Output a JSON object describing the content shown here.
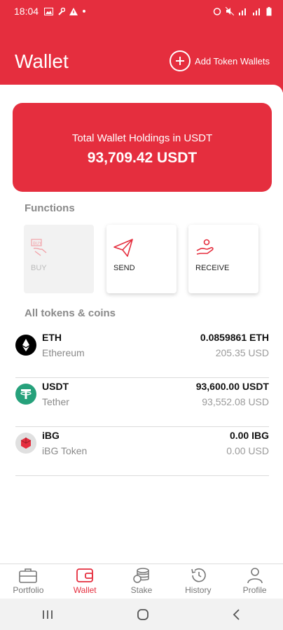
{
  "status_bar": {
    "time": "18:04"
  },
  "header": {
    "title": "Wallet",
    "add_token_label": "Add Token Wallets"
  },
  "holdings": {
    "label": "Total Wallet Holdings in USDT",
    "amount": "93,709.42 USDT"
  },
  "functions": {
    "title": "Functions",
    "items": [
      {
        "label": "BUY",
        "icon": "buy-icon",
        "enabled": false
      },
      {
        "label": "SEND",
        "icon": "send-icon",
        "enabled": true
      },
      {
        "label": "RECEIVE",
        "icon": "receive-icon",
        "enabled": true
      }
    ]
  },
  "tokens": {
    "title": "All tokens & coins",
    "items": [
      {
        "symbol": "ETH",
        "name": "Ethereum",
        "balance": "0.0859861 ETH",
        "usd": "205.35 USD",
        "icon": "ethereum-icon",
        "icon_color": "#000000"
      },
      {
        "symbol": "USDT",
        "name": "Tether",
        "balance": "93,600.00 USDT",
        "usd": "93,552.08 USD",
        "icon": "tether-icon",
        "icon_color": "#26a17b"
      },
      {
        "symbol": "iBG",
        "name": "iBG Token",
        "balance": "0.00 IBG",
        "usd": "0.00 USD",
        "icon": "ibg-icon",
        "icon_color": "#e0e0e0"
      }
    ]
  },
  "bottom_nav": {
    "items": [
      {
        "label": "Portfolio",
        "icon": "briefcase-icon",
        "active": false
      },
      {
        "label": "Wallet",
        "icon": "wallet-icon",
        "active": true
      },
      {
        "label": "Stake",
        "icon": "coins-icon",
        "active": false
      },
      {
        "label": "History",
        "icon": "history-icon",
        "active": false
      },
      {
        "label": "Profile",
        "icon": "person-icon",
        "active": false
      }
    ]
  },
  "colors": {
    "accent": "#e52e3e",
    "muted_text": "#8a8a8a"
  }
}
